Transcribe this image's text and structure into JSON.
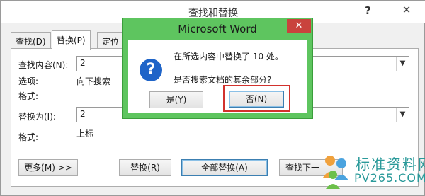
{
  "window": {
    "title": "查找和替换",
    "help": "?",
    "close": "✕"
  },
  "tabs": [
    "查找(D)",
    "替换(P)",
    "定位"
  ],
  "find": {
    "label": "查找内容(N):",
    "value": "2",
    "options_label": "选项:",
    "options_value": "向下搜索",
    "format_label": "格式:"
  },
  "replace": {
    "label": "替换为(I):",
    "value": "2",
    "format_label": "格式:",
    "format_value": "上标"
  },
  "buttons": {
    "more": "更多(M) >>",
    "replace": "替换(R)",
    "replace_all": "全部替换(A)",
    "find_next": "查找下一"
  },
  "dialog": {
    "title": "Microsoft Word",
    "close": "✕",
    "icon": "?",
    "line1": "在所选内容中替换了 10 处。",
    "line2": "是否搜索文档的其余部分?",
    "yes": "是(Y)",
    "no": "否(N)"
  },
  "watermark": {
    "line1": "标准资料网",
    "line2": "PV265.COM"
  }
}
